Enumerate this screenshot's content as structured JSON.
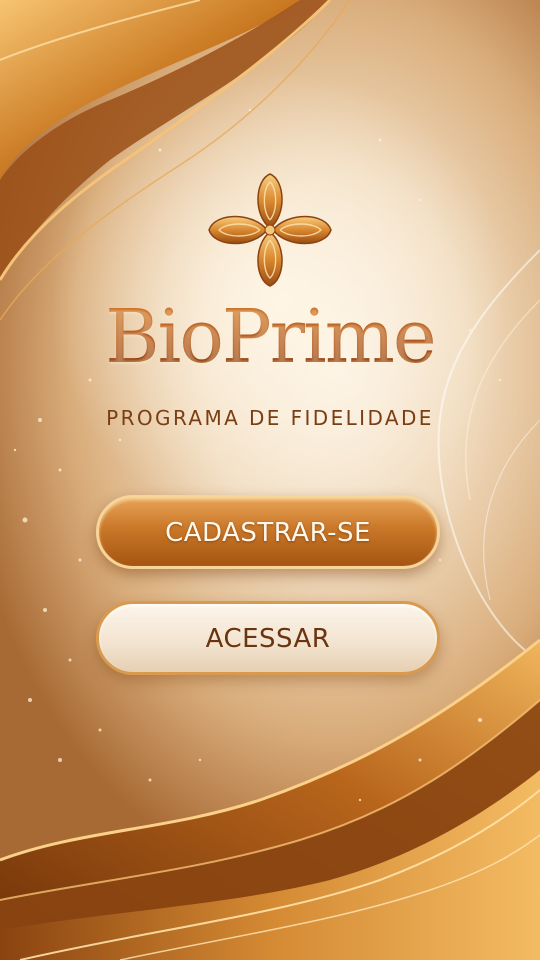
{
  "brand": {
    "name": "BioPrime",
    "tagline": "PROGRAMA DE FIDELIDADE"
  },
  "actions": {
    "register_label": "CADASTRAR-SE",
    "login_label": "ACESSAR"
  },
  "icons": {
    "logo": "four-petal-flower-icon"
  },
  "colors": {
    "brand_text": "#b45a17",
    "primary_button": "#c97728",
    "secondary_button": "#f6ead9",
    "accent_gold": "#e8a356"
  }
}
